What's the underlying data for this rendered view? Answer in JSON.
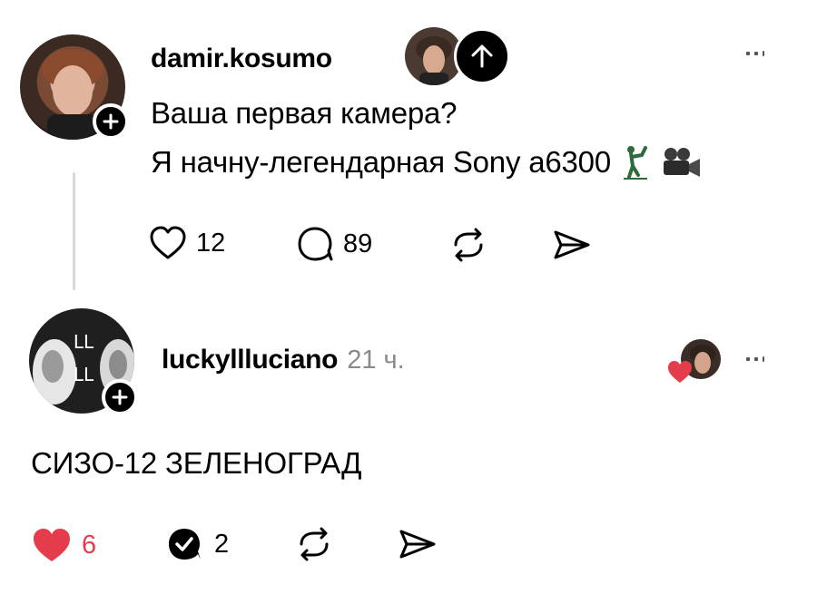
{
  "post": {
    "username": "damir.kosumo",
    "lines": [
      "Ваша первая камера?",
      "Я начну-легендарная Sony a6300"
    ],
    "emojis": [
      "golfer-emoji",
      "movie-camera-emoji"
    ],
    "likes": "12",
    "replies": "89",
    "icons": {
      "like": "heart-icon",
      "reply": "comment-icon",
      "repost": "repost-icon",
      "share": "send-icon",
      "scroll_up": "arrow-up-icon",
      "follow": "plus-icon",
      "more": "more-icon"
    }
  },
  "reply": {
    "username": "luckylllucianо",
    "time": "21 ч.",
    "avatar_text": [
      "LL",
      "LL"
    ],
    "text": "СИЗО-12 ЗЕЛЕНОГРАД",
    "likes": "6",
    "replies": "2",
    "liked": true,
    "icons": {
      "like": "heart-filled-icon",
      "reply": "comment-check-icon",
      "repost": "repost-icon",
      "share": "send-icon",
      "liked_by_author": "heart-badge-icon",
      "more": "more-icon"
    }
  },
  "colors": {
    "like_red": "#e53c4b",
    "text": "#000000",
    "muted": "#8a8a8a",
    "thread_line": "#d9d9d9"
  }
}
